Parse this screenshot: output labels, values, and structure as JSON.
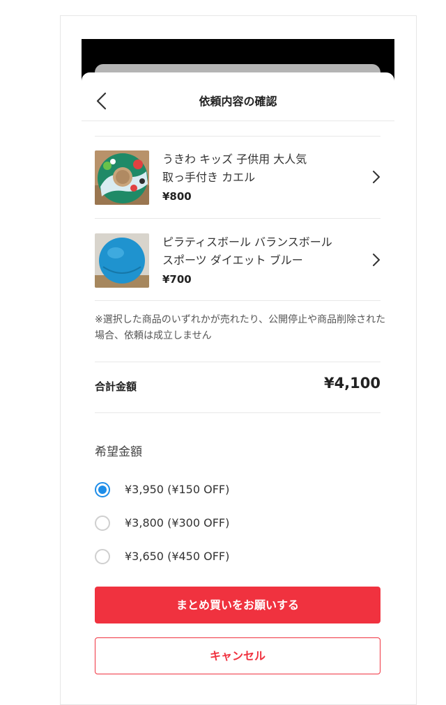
{
  "header": {
    "title": "依頼内容の確認",
    "back_icon": "chevron-left-icon"
  },
  "items": [
    {
      "name_line1": "うきわ キッズ 子供用 大人気",
      "name_line2": "取っ手付き カエル",
      "price": "¥800",
      "thumbnail": "swim-ring-frog-image"
    },
    {
      "name_line1": "ピラティスボール バランスボール",
      "name_line2": "スポーツ ダイエット ブルー",
      "price": "¥700",
      "thumbnail": "blue-balance-ball-image"
    }
  ],
  "notice": "※選択した商品のいずれかが売れたり、公開停止や商品削除された場合、依頼は成立しません",
  "total": {
    "label": "合計金額",
    "value": "¥4,100"
  },
  "desired_price": {
    "title": "希望金額",
    "options": [
      {
        "label": "¥3,950 (¥150 OFF)",
        "selected": true
      },
      {
        "label": "¥3,800 (¥300 OFF)",
        "selected": false
      },
      {
        "label": "¥3,650 (¥450 OFF)",
        "selected": false
      }
    ]
  },
  "actions": {
    "submit_label": "まとめ買いをお願いする",
    "cancel_label": "キャンセル"
  },
  "colors": {
    "accent_red": "#f0323f",
    "radio_blue": "#1e8de8"
  }
}
